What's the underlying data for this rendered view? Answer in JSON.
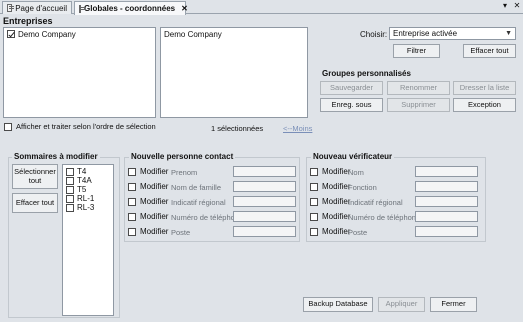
{
  "tabs": [
    {
      "label": "Page d'accueil"
    },
    {
      "label": "Globales - coordonnées"
    }
  ],
  "window": {
    "dropdown_glyph": "▾",
    "close_glyph": "✕"
  },
  "entreprises": {
    "title": "Entreprises",
    "list_left": [
      "Demo Company"
    ],
    "list_right": [
      "Demo Company"
    ],
    "choisir_label": "Choisir:",
    "choisir_value": "Entreprise activée",
    "filtrer_label": "Filtrer",
    "effacer_tout_label": "Effacer tout",
    "order_checkbox_label": "Afficher et traiter selon l'ordre de sélection",
    "selected_count": "1 sélectionnées",
    "moins_link": "<--Moins"
  },
  "groupes": {
    "title": "Groupes personnalisés",
    "buttons": [
      "Sauvegarder",
      "Renommer",
      "Dresser la liste",
      "Enreg. sous",
      "Supprimer",
      "Exception"
    ]
  },
  "sommaires": {
    "title": "Sommaires à modifier",
    "select_all_label": "Sélectionner tout",
    "clear_all_label": "Effacer tout",
    "items": [
      "T4",
      "T4A",
      "T5",
      "RL-1",
      "RL-3"
    ]
  },
  "contact": {
    "title": "Nouvelle personne contact",
    "modifier_label": "Modifier",
    "fields": [
      "Prenom",
      "Nom de famille",
      "Indicatif régional",
      "Numéro de téléphone",
      "Poste"
    ]
  },
  "verificateur": {
    "title": "Nouveau vérificateur",
    "modifier_label": "Modifier",
    "fields": [
      "Nom",
      "Fonction",
      "Indicatif régional",
      "Numéro de téléphone",
      "Poste"
    ]
  },
  "footer": {
    "backup_label": "Backup Database",
    "appliquer_label": "Appliquer",
    "fermer_label": "Fermer"
  }
}
